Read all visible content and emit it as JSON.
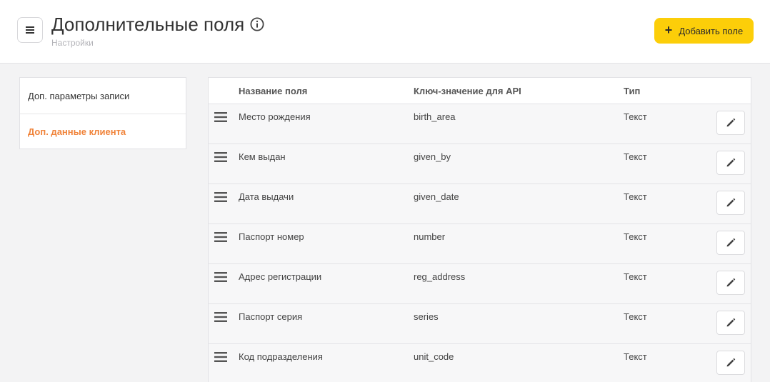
{
  "header": {
    "title": "Дополнительные поля",
    "subtitle": "Настройки",
    "menu_icon": "hamburger-icon",
    "info_icon": "info-icon",
    "add_button": {
      "icon": "plus-icon",
      "label": "Добавить поле"
    }
  },
  "colors": {
    "accent_yellow": "#fcce09",
    "active_orange": "#f0833a",
    "background": "#f3f3f4"
  },
  "sidebar": {
    "items": [
      {
        "label": "Доп. параметры записи",
        "active": false
      },
      {
        "label": "Доп. данные клиента",
        "active": true
      }
    ]
  },
  "table": {
    "columns": [
      "Название поля",
      "Ключ-значение для API",
      "Тип"
    ],
    "row_icons": {
      "drag": "drag-handle-icon",
      "edit": "pencil-icon"
    },
    "rows": [
      {
        "name": "Место рождения",
        "key": "birth_area",
        "type": "Текст"
      },
      {
        "name": "Кем выдан",
        "key": "given_by",
        "type": "Текст"
      },
      {
        "name": "Дата выдачи",
        "key": "given_date",
        "type": "Текст"
      },
      {
        "name": "Паспорт номер",
        "key": "number",
        "type": "Текст"
      },
      {
        "name": "Адрес регистрации",
        "key": "reg_address",
        "type": "Текст"
      },
      {
        "name": "Паспорт серия",
        "key": "series",
        "type": "Текст"
      },
      {
        "name": "Код подразделения",
        "key": "unit_code",
        "type": "Текст"
      }
    ]
  }
}
